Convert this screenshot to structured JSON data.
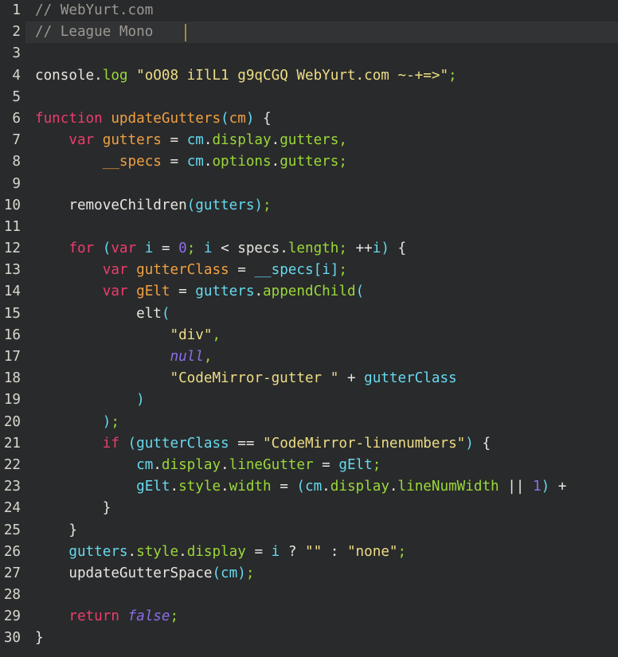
{
  "editor": {
    "name": "code-editor",
    "language": "javascript",
    "font_sample_label": "League Mono",
    "colors": {
      "background": "#292a2b",
      "active_line": "#323334",
      "gutter_text": "#d8d6cf",
      "plain": "#e8e6e1",
      "comment": "#9b9995",
      "keyword": "#ec3d6f",
      "function": "#f0a043",
      "variable": "#f0a043",
      "property": "#9ad83a",
      "string": "#eddd85",
      "number": "#8b6fe8",
      "atom": "#8b6fe8",
      "identifier": "#66d9ef",
      "cursor": "#9a8f3d"
    },
    "cursor": {
      "line": 2,
      "column": 16
    },
    "active_line": 2,
    "first_line_number": 1,
    "last_line_number": 30,
    "lines": [
      {
        "n": "1",
        "tokens": [
          {
            "t": "// WebYurt.com",
            "c": "t-comment"
          }
        ]
      },
      {
        "n": "2",
        "active": true,
        "tokens": [
          {
            "t": "// League Mono ",
            "c": "t-comment"
          }
        ]
      },
      {
        "n": "3",
        "tokens": []
      },
      {
        "n": "4",
        "tokens": [
          {
            "t": "console",
            "c": "t-plain"
          },
          {
            "t": ".",
            "c": "t-punct"
          },
          {
            "t": "log",
            "c": "t-prop"
          },
          {
            "t": " ",
            "c": "t-plain"
          },
          {
            "t": "\"oO08 iIlL1 g9qCGQ WebYurt.com ~-+=>\"",
            "c": "t-str"
          },
          {
            "t": ";",
            "c": "t-semi"
          }
        ]
      },
      {
        "n": "5",
        "tokens": []
      },
      {
        "n": "6",
        "tokens": [
          {
            "t": "function",
            "c": "t-kw"
          },
          {
            "t": " ",
            "c": "t-plain"
          },
          {
            "t": "updateGutters",
            "c": "t-fn"
          },
          {
            "t": "(",
            "c": "t-ident"
          },
          {
            "t": "cm",
            "c": "t-fn"
          },
          {
            "t": ")",
            "c": "t-ident"
          },
          {
            "t": " ",
            "c": "t-plain"
          },
          {
            "t": "{",
            "c": "t-plain"
          }
        ]
      },
      {
        "n": "7",
        "tokens": [
          {
            "t": "    ",
            "c": "t-plain"
          },
          {
            "t": "var",
            "c": "t-kw"
          },
          {
            "t": " ",
            "c": "t-plain"
          },
          {
            "t": "gutters",
            "c": "t-var"
          },
          {
            "t": " ",
            "c": "t-plain"
          },
          {
            "t": "=",
            "c": "t-op"
          },
          {
            "t": " ",
            "c": "t-plain"
          },
          {
            "t": "cm",
            "c": "t-ident"
          },
          {
            "t": ".",
            "c": "t-punct"
          },
          {
            "t": "display",
            "c": "t-prop"
          },
          {
            "t": ".",
            "c": "t-punct"
          },
          {
            "t": "gutters",
            "c": "t-prop"
          },
          {
            "t": ",",
            "c": "t-semi"
          }
        ]
      },
      {
        "n": "8",
        "tokens": [
          {
            "t": "        ",
            "c": "t-plain"
          },
          {
            "t": "__specs",
            "c": "t-var"
          },
          {
            "t": " ",
            "c": "t-plain"
          },
          {
            "t": "=",
            "c": "t-op"
          },
          {
            "t": " ",
            "c": "t-plain"
          },
          {
            "t": "cm",
            "c": "t-ident"
          },
          {
            "t": ".",
            "c": "t-punct"
          },
          {
            "t": "options",
            "c": "t-prop"
          },
          {
            "t": ".",
            "c": "t-punct"
          },
          {
            "t": "gutters",
            "c": "t-prop"
          },
          {
            "t": ";",
            "c": "t-semi"
          }
        ]
      },
      {
        "n": "9",
        "tokens": []
      },
      {
        "n": "10",
        "tokens": [
          {
            "t": "    ",
            "c": "t-plain"
          },
          {
            "t": "removeChildren",
            "c": "t-plain"
          },
          {
            "t": "(",
            "c": "t-ident"
          },
          {
            "t": "gutters",
            "c": "t-ident"
          },
          {
            "t": ")",
            "c": "t-ident"
          },
          {
            "t": ";",
            "c": "t-semi"
          }
        ]
      },
      {
        "n": "11",
        "tokens": []
      },
      {
        "n": "12",
        "tokens": [
          {
            "t": "    ",
            "c": "t-plain"
          },
          {
            "t": "for",
            "c": "t-kw"
          },
          {
            "t": " ",
            "c": "t-plain"
          },
          {
            "t": "(",
            "c": "t-ident"
          },
          {
            "t": "var",
            "c": "t-kw"
          },
          {
            "t": " ",
            "c": "t-plain"
          },
          {
            "t": "i",
            "c": "t-ident"
          },
          {
            "t": " ",
            "c": "t-plain"
          },
          {
            "t": "=",
            "c": "t-op"
          },
          {
            "t": " ",
            "c": "t-plain"
          },
          {
            "t": "0",
            "c": "t-num"
          },
          {
            "t": ";",
            "c": "t-semi"
          },
          {
            "t": " ",
            "c": "t-plain"
          },
          {
            "t": "i",
            "c": "t-ident"
          },
          {
            "t": " ",
            "c": "t-plain"
          },
          {
            "t": "<",
            "c": "t-op"
          },
          {
            "t": " ",
            "c": "t-plain"
          },
          {
            "t": "specs",
            "c": "t-plain"
          },
          {
            "t": ".",
            "c": "t-punct"
          },
          {
            "t": "length",
            "c": "t-prop"
          },
          {
            "t": ";",
            "c": "t-semi"
          },
          {
            "t": " ",
            "c": "t-plain"
          },
          {
            "t": "++",
            "c": "t-op"
          },
          {
            "t": "i",
            "c": "t-ident"
          },
          {
            "t": ")",
            "c": "t-ident"
          },
          {
            "t": " ",
            "c": "t-plain"
          },
          {
            "t": "{",
            "c": "t-plain"
          }
        ]
      },
      {
        "n": "13",
        "tokens": [
          {
            "t": "        ",
            "c": "t-plain"
          },
          {
            "t": "var",
            "c": "t-kw"
          },
          {
            "t": " ",
            "c": "t-plain"
          },
          {
            "t": "gutterClass",
            "c": "t-var"
          },
          {
            "t": " ",
            "c": "t-plain"
          },
          {
            "t": "=",
            "c": "t-op"
          },
          {
            "t": " ",
            "c": "t-plain"
          },
          {
            "t": "__specs",
            "c": "t-ident"
          },
          {
            "t": "[",
            "c": "t-ident"
          },
          {
            "t": "i",
            "c": "t-ident"
          },
          {
            "t": "]",
            "c": "t-ident"
          },
          {
            "t": ";",
            "c": "t-semi"
          }
        ]
      },
      {
        "n": "14",
        "tokens": [
          {
            "t": "        ",
            "c": "t-plain"
          },
          {
            "t": "var",
            "c": "t-kw"
          },
          {
            "t": " ",
            "c": "t-plain"
          },
          {
            "t": "gElt",
            "c": "t-var"
          },
          {
            "t": " ",
            "c": "t-plain"
          },
          {
            "t": "=",
            "c": "t-op"
          },
          {
            "t": " ",
            "c": "t-plain"
          },
          {
            "t": "gutters",
            "c": "t-ident"
          },
          {
            "t": ".",
            "c": "t-punct"
          },
          {
            "t": "appendChild",
            "c": "t-prop"
          },
          {
            "t": "(",
            "c": "t-ident"
          }
        ]
      },
      {
        "n": "15",
        "tokens": [
          {
            "t": "            ",
            "c": "t-plain"
          },
          {
            "t": "elt",
            "c": "t-plain"
          },
          {
            "t": "(",
            "c": "t-ident"
          }
        ]
      },
      {
        "n": "16",
        "tokens": [
          {
            "t": "                ",
            "c": "t-plain"
          },
          {
            "t": "\"div\"",
            "c": "t-str"
          },
          {
            "t": ",",
            "c": "t-semi"
          }
        ]
      },
      {
        "n": "17",
        "tokens": [
          {
            "t": "                ",
            "c": "t-plain"
          },
          {
            "t": "null",
            "c": "t-atom"
          },
          {
            "t": ",",
            "c": "t-semi"
          }
        ]
      },
      {
        "n": "18",
        "tokens": [
          {
            "t": "                ",
            "c": "t-plain"
          },
          {
            "t": "\"CodeMirror-gutter \"",
            "c": "t-str"
          },
          {
            "t": " ",
            "c": "t-plain"
          },
          {
            "t": "+",
            "c": "t-op"
          },
          {
            "t": " ",
            "c": "t-plain"
          },
          {
            "t": "gutterClass",
            "c": "t-ident"
          }
        ]
      },
      {
        "n": "19",
        "tokens": [
          {
            "t": "            ",
            "c": "t-plain"
          },
          {
            "t": ")",
            "c": "t-ident"
          }
        ]
      },
      {
        "n": "20",
        "tokens": [
          {
            "t": "        ",
            "c": "t-plain"
          },
          {
            "t": ")",
            "c": "t-ident"
          },
          {
            "t": ";",
            "c": "t-semi"
          }
        ]
      },
      {
        "n": "21",
        "tokens": [
          {
            "t": "        ",
            "c": "t-plain"
          },
          {
            "t": "if",
            "c": "t-kw"
          },
          {
            "t": " ",
            "c": "t-plain"
          },
          {
            "t": "(",
            "c": "t-ident"
          },
          {
            "t": "gutterClass",
            "c": "t-ident"
          },
          {
            "t": " ",
            "c": "t-plain"
          },
          {
            "t": "==",
            "c": "t-op"
          },
          {
            "t": " ",
            "c": "t-plain"
          },
          {
            "t": "\"CodeMirror-linenumbers\"",
            "c": "t-str"
          },
          {
            "t": ")",
            "c": "t-ident"
          },
          {
            "t": " ",
            "c": "t-plain"
          },
          {
            "t": "{",
            "c": "t-plain"
          }
        ]
      },
      {
        "n": "22",
        "tokens": [
          {
            "t": "            ",
            "c": "t-plain"
          },
          {
            "t": "cm",
            "c": "t-ident"
          },
          {
            "t": ".",
            "c": "t-punct"
          },
          {
            "t": "display",
            "c": "t-prop"
          },
          {
            "t": ".",
            "c": "t-punct"
          },
          {
            "t": "lineGutter",
            "c": "t-prop"
          },
          {
            "t": " ",
            "c": "t-plain"
          },
          {
            "t": "=",
            "c": "t-op"
          },
          {
            "t": " ",
            "c": "t-plain"
          },
          {
            "t": "gElt",
            "c": "t-ident"
          },
          {
            "t": ";",
            "c": "t-semi"
          }
        ]
      },
      {
        "n": "23",
        "tokens": [
          {
            "t": "            ",
            "c": "t-plain"
          },
          {
            "t": "gElt",
            "c": "t-ident"
          },
          {
            "t": ".",
            "c": "t-punct"
          },
          {
            "t": "style",
            "c": "t-prop"
          },
          {
            "t": ".",
            "c": "t-punct"
          },
          {
            "t": "width",
            "c": "t-prop"
          },
          {
            "t": " ",
            "c": "t-plain"
          },
          {
            "t": "=",
            "c": "t-op"
          },
          {
            "t": " ",
            "c": "t-plain"
          },
          {
            "t": "(",
            "c": "t-ident"
          },
          {
            "t": "cm",
            "c": "t-ident"
          },
          {
            "t": ".",
            "c": "t-punct"
          },
          {
            "t": "display",
            "c": "t-prop"
          },
          {
            "t": ".",
            "c": "t-punct"
          },
          {
            "t": "lineNumWidth",
            "c": "t-prop"
          },
          {
            "t": " ",
            "c": "t-plain"
          },
          {
            "t": "||",
            "c": "t-op"
          },
          {
            "t": " ",
            "c": "t-plain"
          },
          {
            "t": "1",
            "c": "t-num"
          },
          {
            "t": ")",
            "c": "t-ident"
          },
          {
            "t": " ",
            "c": "t-plain"
          },
          {
            "t": "+",
            "c": "t-op"
          }
        ]
      },
      {
        "n": "24",
        "tokens": [
          {
            "t": "        ",
            "c": "t-plain"
          },
          {
            "t": "}",
            "c": "t-plain"
          }
        ]
      },
      {
        "n": "25",
        "tokens": [
          {
            "t": "    ",
            "c": "t-plain"
          },
          {
            "t": "}",
            "c": "t-plain"
          }
        ]
      },
      {
        "n": "26",
        "tokens": [
          {
            "t": "    ",
            "c": "t-plain"
          },
          {
            "t": "gutters",
            "c": "t-ident"
          },
          {
            "t": ".",
            "c": "t-punct"
          },
          {
            "t": "style",
            "c": "t-prop"
          },
          {
            "t": ".",
            "c": "t-punct"
          },
          {
            "t": "display",
            "c": "t-prop"
          },
          {
            "t": " ",
            "c": "t-plain"
          },
          {
            "t": "=",
            "c": "t-op"
          },
          {
            "t": " ",
            "c": "t-plain"
          },
          {
            "t": "i",
            "c": "t-ident"
          },
          {
            "t": " ",
            "c": "t-plain"
          },
          {
            "t": "?",
            "c": "t-op"
          },
          {
            "t": " ",
            "c": "t-plain"
          },
          {
            "t": "\"\"",
            "c": "t-str"
          },
          {
            "t": " ",
            "c": "t-plain"
          },
          {
            "t": ":",
            "c": "t-op"
          },
          {
            "t": " ",
            "c": "t-plain"
          },
          {
            "t": "\"none\"",
            "c": "t-str"
          },
          {
            "t": ";",
            "c": "t-semi"
          }
        ]
      },
      {
        "n": "27",
        "tokens": [
          {
            "t": "    ",
            "c": "t-plain"
          },
          {
            "t": "updateGutterSpace",
            "c": "t-plain"
          },
          {
            "t": "(",
            "c": "t-ident"
          },
          {
            "t": "cm",
            "c": "t-ident"
          },
          {
            "t": ")",
            "c": "t-ident"
          },
          {
            "t": ";",
            "c": "t-semi"
          }
        ]
      },
      {
        "n": "28",
        "tokens": []
      },
      {
        "n": "29",
        "tokens": [
          {
            "t": "    ",
            "c": "t-plain"
          },
          {
            "t": "return",
            "c": "t-kw"
          },
          {
            "t": " ",
            "c": "t-plain"
          },
          {
            "t": "false",
            "c": "t-atom"
          },
          {
            "t": ";",
            "c": "t-semi"
          }
        ]
      },
      {
        "n": "30",
        "tokens": [
          {
            "t": "}",
            "c": "t-plain"
          }
        ]
      }
    ]
  }
}
